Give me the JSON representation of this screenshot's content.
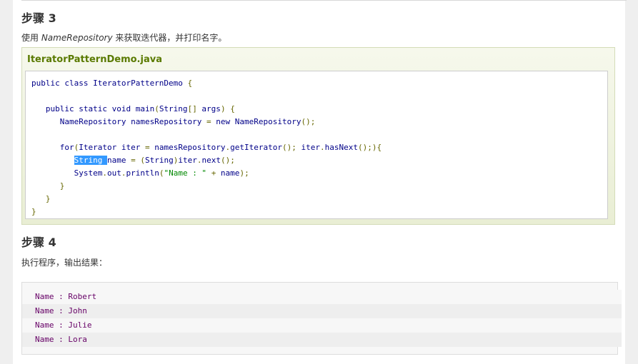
{
  "step3": {
    "title": "步骤 3",
    "desc_prefix": "使用 ",
    "desc_italic": "NameRepository",
    "desc_suffix": " 来获取迭代器，并打印名字。"
  },
  "example": {
    "filename": "IteratorPatternDemo.java",
    "code_lines": [
      "public class IteratorPatternDemo {",
      "",
      "   public static void main(String[] args) {",
      "      NameRepository namesRepository = new NameRepository();",
      "",
      "      for(Iterator iter = namesRepository.getIterator(); iter.hasNext();){",
      "         String name = (String)iter.next();",
      "         System.out.println(\"Name : \" + name);",
      "      }",
      "   }",
      "}"
    ],
    "selected_text": "String "
  },
  "step4": {
    "title": "步骤 4",
    "desc": "执行程序，输出结果："
  },
  "output": {
    "lines": [
      "Name : Robert",
      "Name : John",
      "Name : Julie",
      "Name : Lora"
    ]
  }
}
